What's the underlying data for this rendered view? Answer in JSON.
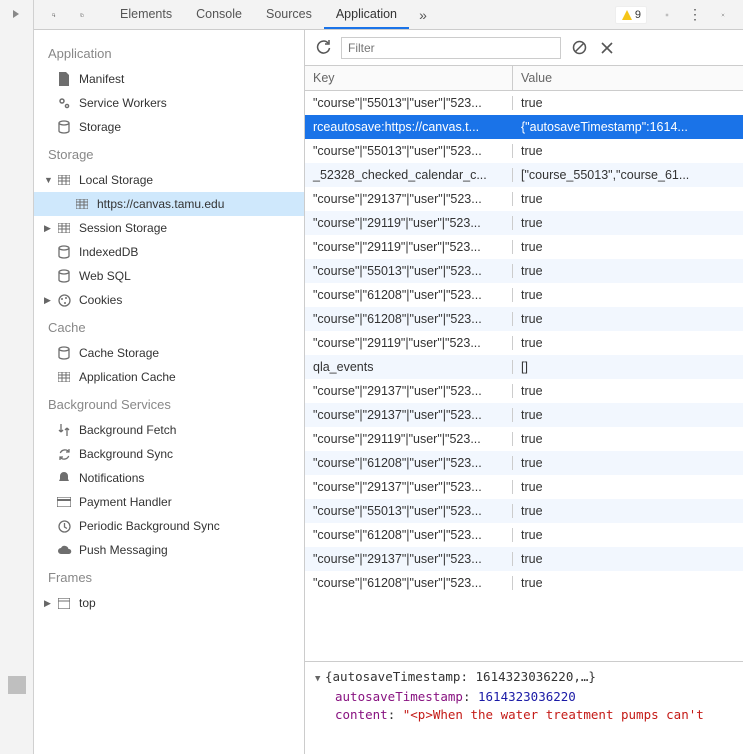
{
  "tabs": [
    "Elements",
    "Console",
    "Sources",
    "Application"
  ],
  "active_tab": "Application",
  "warning_count": "9",
  "filter_placeholder": "Filter",
  "sidebar": {
    "application": {
      "title": "Application",
      "items": [
        "Manifest",
        "Service Workers",
        "Storage"
      ]
    },
    "storage": {
      "title": "Storage",
      "items": [
        "Local Storage",
        "https://canvas.tamu.edu",
        "Session Storage",
        "IndexedDB",
        "Web SQL",
        "Cookies"
      ]
    },
    "cache": {
      "title": "Cache",
      "items": [
        "Cache Storage",
        "Application Cache"
      ]
    },
    "background": {
      "title": "Background Services",
      "items": [
        "Background Fetch",
        "Background Sync",
        "Notifications",
        "Payment Handler",
        "Periodic Background Sync",
        "Push Messaging"
      ]
    },
    "frames": {
      "title": "Frames",
      "items": [
        "top"
      ]
    }
  },
  "columns": {
    "key": "Key",
    "value": "Value"
  },
  "rows": [
    {
      "key": "\"course\"|\"55013\"|\"user\"|\"523...",
      "value": "true",
      "sel": false
    },
    {
      "key": "rceautosave:https://canvas.t...",
      "value": "{\"autosaveTimestamp\":1614...",
      "sel": true
    },
    {
      "key": "\"course\"|\"55013\"|\"user\"|\"523...",
      "value": "true",
      "sel": false
    },
    {
      "key": "_52328_checked_calendar_c...",
      "value": "[\"course_55013\",\"course_61...",
      "sel": false
    },
    {
      "key": "\"course\"|\"29137\"|\"user\"|\"523...",
      "value": "true",
      "sel": false
    },
    {
      "key": "\"course\"|\"29119\"|\"user\"|\"523...",
      "value": "true",
      "sel": false
    },
    {
      "key": "\"course\"|\"29119\"|\"user\"|\"523...",
      "value": "true",
      "sel": false
    },
    {
      "key": "\"course\"|\"55013\"|\"user\"|\"523...",
      "value": "true",
      "sel": false
    },
    {
      "key": "\"course\"|\"61208\"|\"user\"|\"523...",
      "value": "true",
      "sel": false
    },
    {
      "key": "\"course\"|\"61208\"|\"user\"|\"523...",
      "value": "true",
      "sel": false
    },
    {
      "key": "\"course\"|\"29119\"|\"user\"|\"523...",
      "value": "true",
      "sel": false
    },
    {
      "key": "qla_events",
      "value": "[]",
      "sel": false
    },
    {
      "key": "\"course\"|\"29137\"|\"user\"|\"523...",
      "value": "true",
      "sel": false
    },
    {
      "key": "\"course\"|\"29137\"|\"user\"|\"523...",
      "value": "true",
      "sel": false
    },
    {
      "key": "\"course\"|\"29119\"|\"user\"|\"523...",
      "value": "true",
      "sel": false
    },
    {
      "key": "\"course\"|\"61208\"|\"user\"|\"523...",
      "value": "true",
      "sel": false
    },
    {
      "key": "\"course\"|\"29137\"|\"user\"|\"523...",
      "value": "true",
      "sel": false
    },
    {
      "key": "\"course\"|\"55013\"|\"user\"|\"523...",
      "value": "true",
      "sel": false
    },
    {
      "key": "\"course\"|\"61208\"|\"user\"|\"523...",
      "value": "true",
      "sel": false
    },
    {
      "key": "\"course\"|\"29137\"|\"user\"|\"523...",
      "value": "true",
      "sel": false
    },
    {
      "key": "\"course\"|\"61208\"|\"user\"|\"523...",
      "value": "true",
      "sel": false
    }
  ],
  "detail": {
    "summary": "{autosaveTimestamp: 1614323036220,…}",
    "prop1_name": "autosaveTimestamp",
    "prop1_value": "1614323036220",
    "prop2_name": "content",
    "prop2_value": "\"<p>When the water treatment pumps can't"
  }
}
